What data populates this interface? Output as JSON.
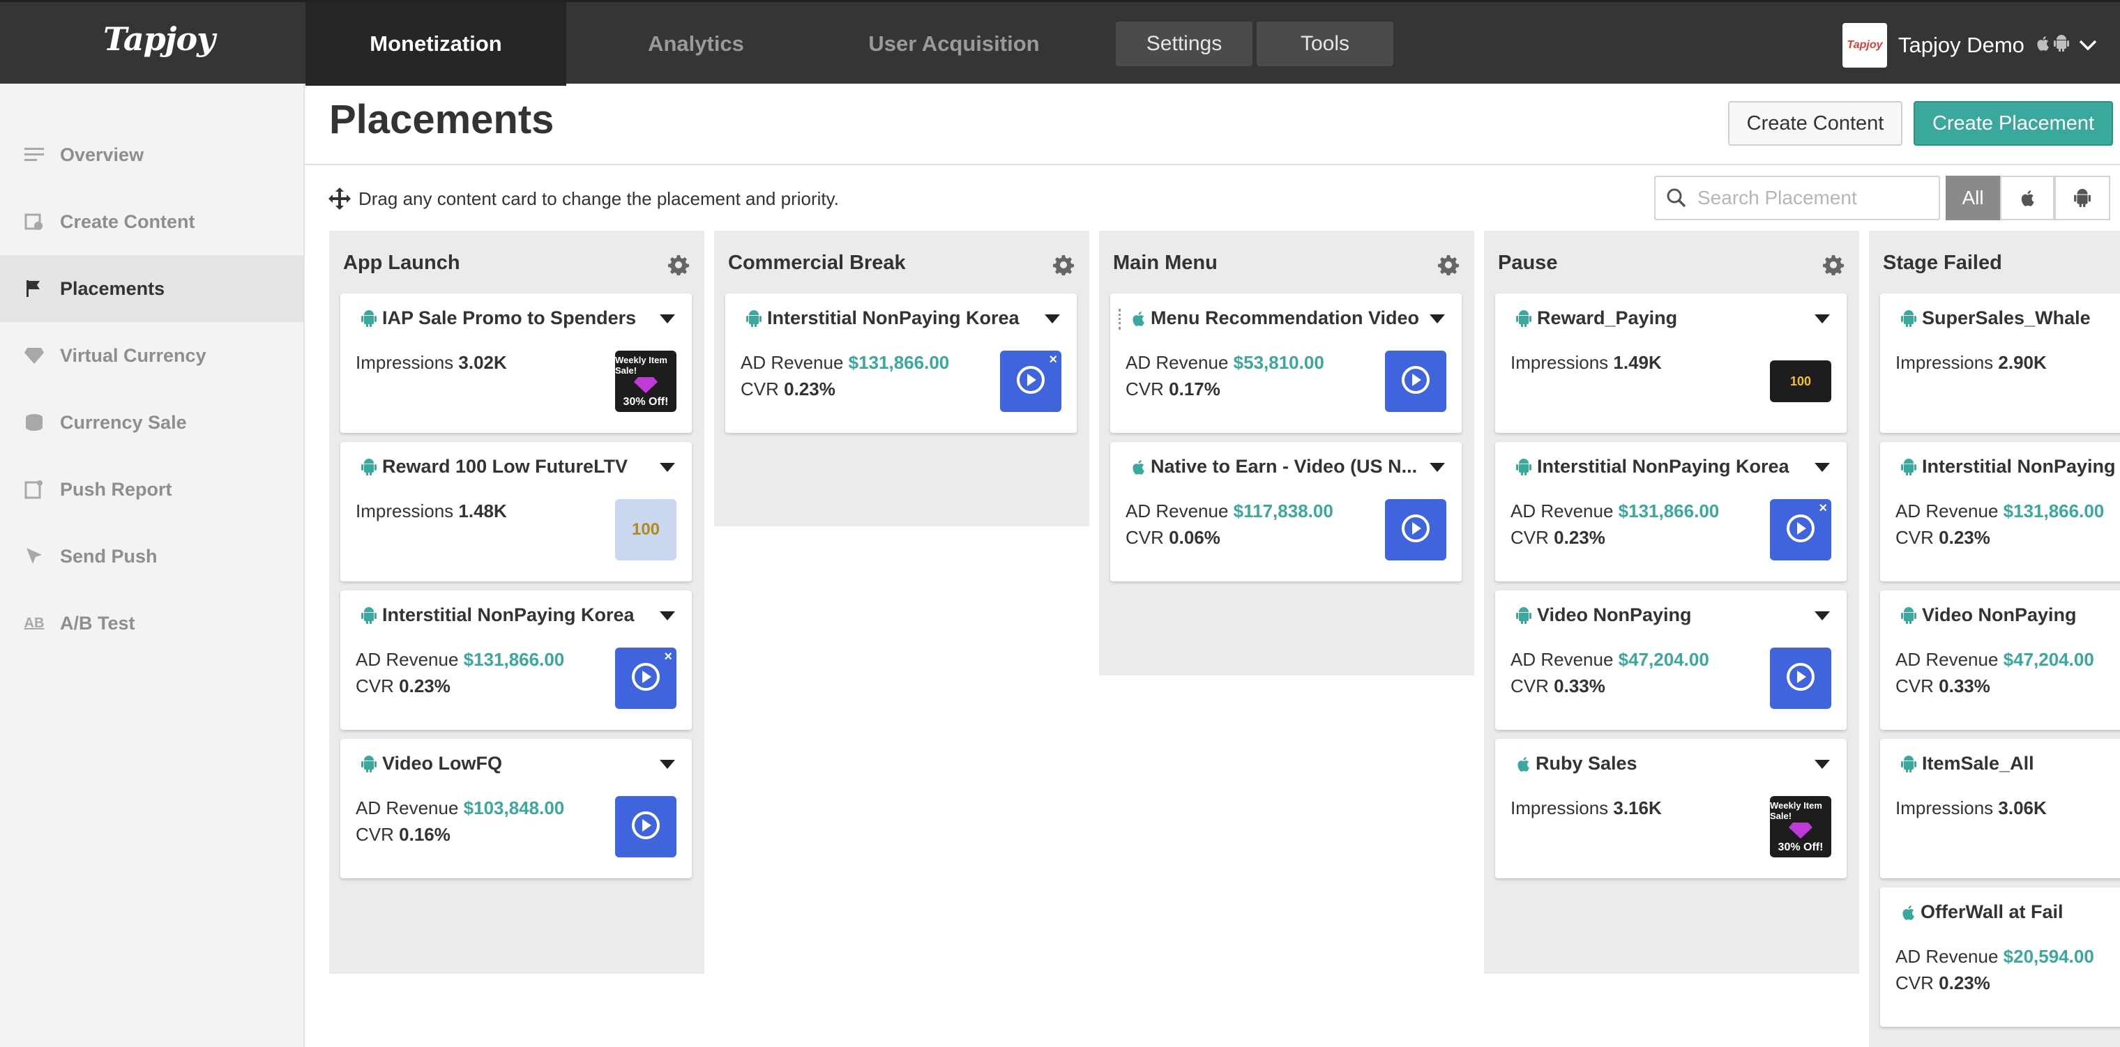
{
  "app": {
    "logo": "Tapjoy"
  },
  "nav": {
    "tabs": [
      "Monetization",
      "Analytics",
      "User Acquisition"
    ],
    "settings": "Settings",
    "tools": "Tools"
  },
  "account": {
    "logo_text": "Tapjoy",
    "name": "Tapjoy Demo"
  },
  "sidebar": {
    "items": [
      {
        "label": "Overview",
        "icon": "list-icon"
      },
      {
        "label": "Create Content",
        "icon": "create-content-icon"
      },
      {
        "label": "Placements",
        "icon": "flag-icon"
      },
      {
        "label": "Virtual Currency",
        "icon": "diamond-icon"
      },
      {
        "label": "Currency Sale",
        "icon": "coins-icon"
      },
      {
        "label": "Push Report",
        "icon": "push-report-icon"
      },
      {
        "label": "Send Push",
        "icon": "cursor-icon"
      },
      {
        "label": "A/B Test",
        "icon": "ab-icon"
      }
    ]
  },
  "page": {
    "title": "Placements",
    "create_content": "Create Content",
    "create_placement": "Create Placement",
    "hint": "Drag any content card to change the placement and priority."
  },
  "search": {
    "placeholder": "Search Placement"
  },
  "filters": {
    "all": "All"
  },
  "labels": {
    "impressions": "Impressions",
    "ad_revenue": "AD Revenue",
    "cvr": "CVR"
  },
  "columns": [
    {
      "title": "App Launch",
      "cards": [
        {
          "title": "IAP Sale Promo to Spenders",
          "platform": "android",
          "impressions": "3.02K",
          "thumb": "sale",
          "thumb_l1": "Weekly Item Sale!",
          "thumb_l2": "30% Off!"
        },
        {
          "title": "Reward 100 Low FutureLTV",
          "platform": "android",
          "impressions": "1.48K",
          "thumb": "coins",
          "thumb_l1": "100"
        },
        {
          "title": "Interstitial NonPaying Korea",
          "platform": "android",
          "revenue": "$131,866.00",
          "cvr": "0.23%",
          "thumb": "video",
          "closable": true
        },
        {
          "title": "Video LowFQ",
          "platform": "android",
          "revenue": "$103,848.00",
          "cvr": "0.16%",
          "thumb": "video"
        }
      ]
    },
    {
      "title": "Commercial Break",
      "cards": [
        {
          "title": "Interstitial NonPaying Korea",
          "platform": "android",
          "revenue": "$131,866.00",
          "cvr": "0.23%",
          "thumb": "video",
          "closable": true
        }
      ]
    },
    {
      "title": "Main Menu",
      "cards": [
        {
          "title": "Menu Recommendation Video",
          "platform": "ios",
          "revenue": "$53,810.00",
          "cvr": "0.17%",
          "thumb": "video",
          "dragging": true
        },
        {
          "title": "Native to Earn - Video (US N...",
          "platform": "ios",
          "revenue": "$117,838.00",
          "cvr": "0.06%",
          "thumb": "video"
        }
      ]
    },
    {
      "title": "Pause",
      "cards": [
        {
          "title": "Reward_Paying",
          "platform": "android",
          "impressions": "1.49K",
          "thumb": "wide",
          "thumb_l1": "100"
        },
        {
          "title": "Interstitial NonPaying Korea",
          "platform": "android",
          "revenue": "$131,866.00",
          "cvr": "0.23%",
          "thumb": "video",
          "closable": true
        },
        {
          "title": "Video NonPaying",
          "platform": "android",
          "revenue": "$47,204.00",
          "cvr": "0.33%",
          "thumb": "video"
        },
        {
          "title": "Ruby Sales",
          "platform": "ios",
          "impressions": "3.16K",
          "thumb": "sale",
          "thumb_l1": "Weekly Item Sale!",
          "thumb_l2": "30% Off!"
        }
      ]
    },
    {
      "title": "Stage Failed",
      "cards": [
        {
          "title": "SuperSales_Whale",
          "platform": "android",
          "impressions": "2.90K"
        },
        {
          "title": "Interstitial NonPaying",
          "platform": "android",
          "revenue": "$131,866.00",
          "cvr": "0.23%"
        },
        {
          "title": "Video NonPaying",
          "platform": "android",
          "revenue": "$47,204.00",
          "cvr": "0.33%"
        },
        {
          "title": "ItemSale_All",
          "platform": "android",
          "impressions": "3.06K"
        },
        {
          "title": "OfferWall at Fail",
          "platform": "ios",
          "revenue": "$20,594.00",
          "cvr": "0.23%"
        }
      ]
    }
  ],
  "colors": {
    "topbar": "#353535",
    "accent": "#3aa89c",
    "video_thumb": "#3f64dc",
    "column_bg": "#ebebeb"
  }
}
